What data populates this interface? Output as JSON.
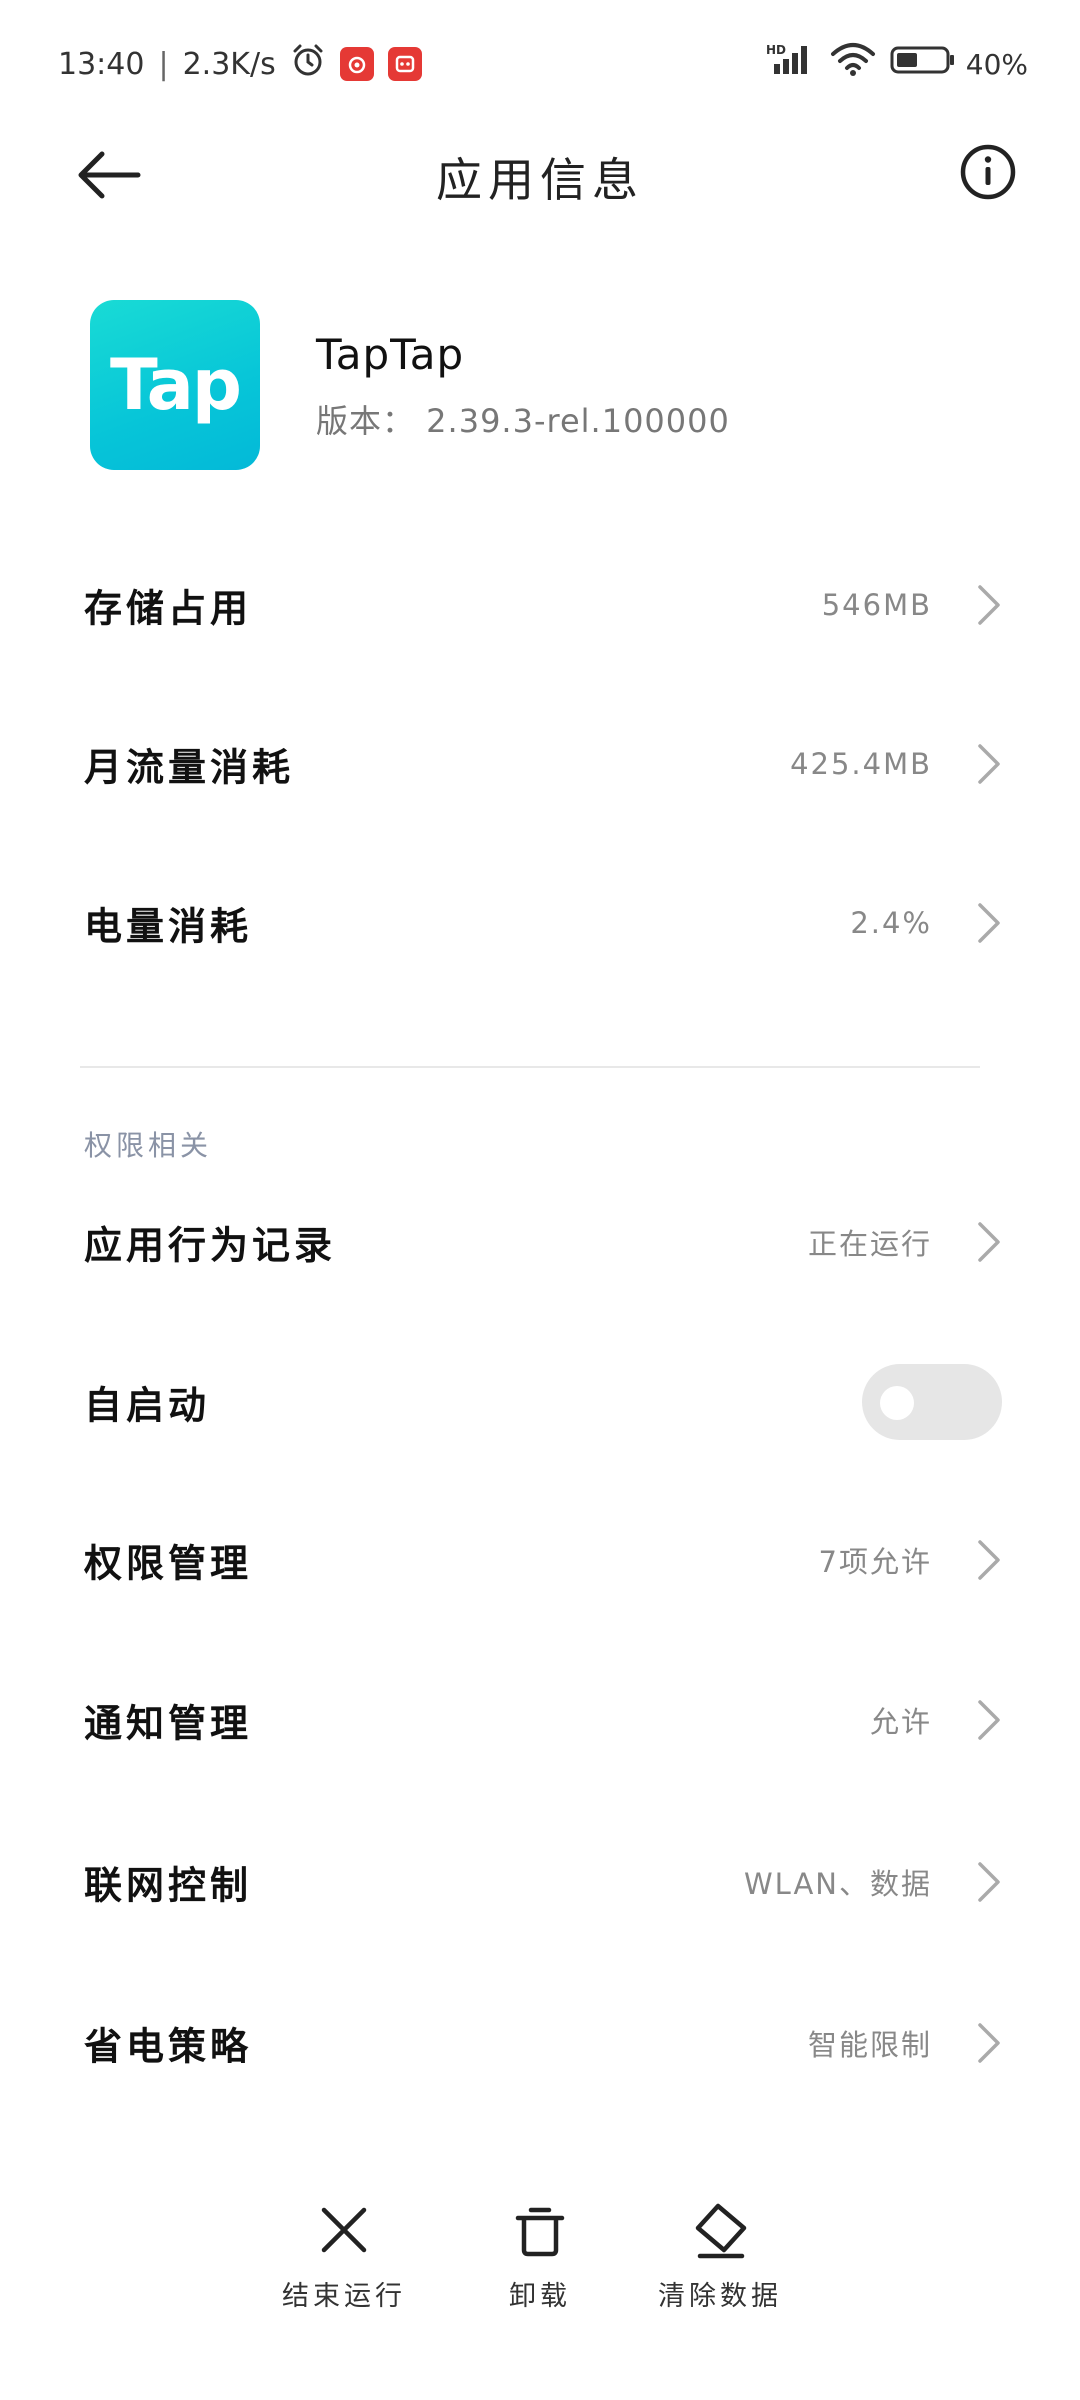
{
  "status_bar": {
    "time": "13:40",
    "speed": "2.3K/s",
    "battery_text": "40%",
    "icons": [
      "alarm-icon",
      "netease-music-icon",
      "app-notification-icon",
      "hd-signal-icon",
      "wifi-icon",
      "battery-icon"
    ]
  },
  "header": {
    "title": "应用信息",
    "back_icon": "arrow-left-icon",
    "info_icon": "info-icon"
  },
  "app": {
    "icon_text": "Tap",
    "name": "TapTap",
    "version": "版本： 2.39.3-rel.100000",
    "icon_color": "#0bc9d8"
  },
  "usage_rows": [
    {
      "label": "存储占用",
      "value": "546MB"
    },
    {
      "label": "月流量消耗",
      "value": "425.4MB"
    },
    {
      "label": "电量消耗",
      "value": "2.4%"
    }
  ],
  "permissions": {
    "section_title": "权限相关",
    "rows": [
      {
        "label": "应用行为记录",
        "value": "正在运行"
      },
      {
        "label": "自启动",
        "toggle": false
      },
      {
        "label": "权限管理",
        "value": "7项允许"
      },
      {
        "label": "通知管理",
        "value": "允许"
      },
      {
        "label": "联网控制",
        "value": "WLAN、数据"
      },
      {
        "label": "省电策略",
        "value": "智能限制"
      }
    ]
  },
  "actions": [
    {
      "label": "结束运行",
      "icon": "close-icon"
    },
    {
      "label": "卸载",
      "icon": "trash-icon"
    },
    {
      "label": "清除数据",
      "icon": "eraser-icon"
    }
  ]
}
